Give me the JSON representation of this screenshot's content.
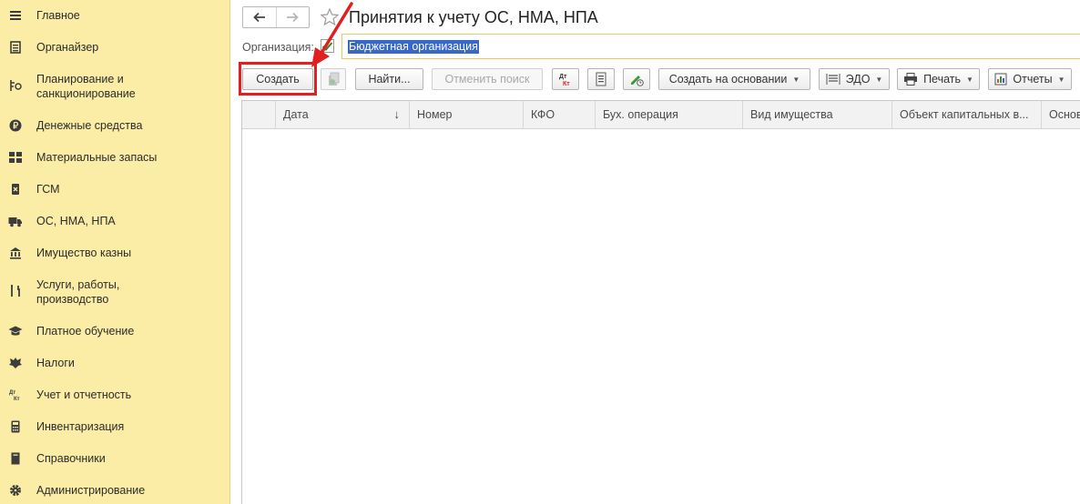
{
  "sidebar": {
    "items": [
      {
        "label": "Главное",
        "icon": "menu-icon"
      },
      {
        "label": "Органайзер",
        "icon": "organizer-icon"
      },
      {
        "label": "Планирование и\nсанкционирование",
        "icon": "planning-icon"
      },
      {
        "label": "Денежные средства",
        "icon": "ruble-icon"
      },
      {
        "label": "Материальные запасы",
        "icon": "inventory-icon"
      },
      {
        "label": "ГСМ",
        "icon": "fuel-icon"
      },
      {
        "label": "ОС, НМА, НПА",
        "icon": "truck-icon"
      },
      {
        "label": "Имущество казны",
        "icon": "bank-icon"
      },
      {
        "label": "Услуги, работы,\nпроизводство",
        "icon": "tools-icon"
      },
      {
        "label": "Платное обучение",
        "icon": "graduation-cap-icon"
      },
      {
        "label": "Налоги",
        "icon": "emblem-icon"
      },
      {
        "label": "Учет и отчетность",
        "icon": "dt-kt-icon"
      },
      {
        "label": "Инвентаризация",
        "icon": "calculator-icon"
      },
      {
        "label": "Справочники",
        "icon": "book-icon"
      },
      {
        "label": "Администрирование",
        "icon": "gear-icon"
      }
    ]
  },
  "header": {
    "title": "Принятия к учету ОС, НМА, НПА"
  },
  "organization": {
    "label": "Организация:",
    "checked": true,
    "value": "Бюджетная организация"
  },
  "toolbar": {
    "create_label": "Создать",
    "find_label": "Найти...",
    "cancel_search_label": "Отменить поиск",
    "dt_kt_label": "Дт\nКт",
    "create_based_label": "Создать на основании",
    "edo_label": "ЭДО",
    "print_label": "Печать",
    "reports_label": "Отчеты"
  },
  "table": {
    "columns": [
      "Дата",
      "Номер",
      "КФО",
      "Бух. операция",
      "Вид имущества",
      "Объект капитальных в...",
      "Основ"
    ]
  },
  "colors": {
    "sidebar_bg": "#fbeda5",
    "highlight": "#e02020",
    "selection": "#3768c8",
    "field_border": "#f0c75e"
  }
}
